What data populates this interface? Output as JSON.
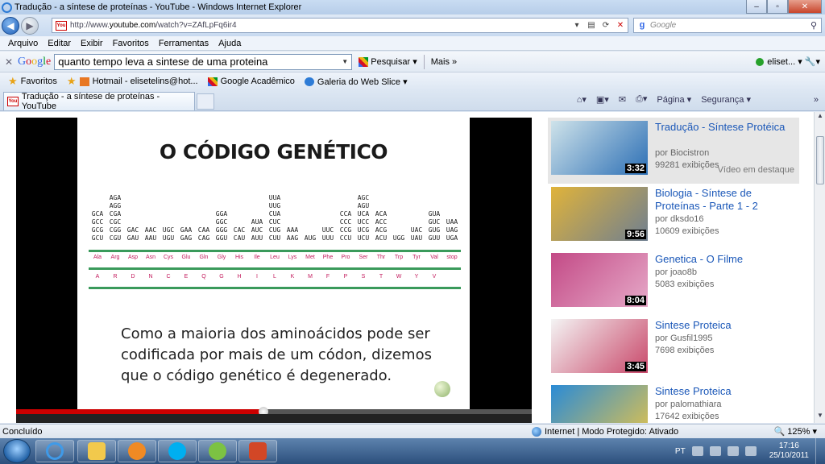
{
  "window": {
    "title": "Tradução - a síntese de proteínas - YouTube - Windows Internet Explorer",
    "buttons": [
      "–",
      "▫",
      "✕"
    ]
  },
  "address_bar": {
    "url_prefix": "http://www.",
    "url_domain": "youtube.com",
    "url_path": "/watch?v=ZAfLpFq6ir4",
    "search_placeholder": "Google"
  },
  "menu": [
    "Arquivo",
    "Editar",
    "Exibir",
    "Favoritos",
    "Ferramentas",
    "Ajuda"
  ],
  "google_toolbar": {
    "logo": "Google",
    "query": "quanto tempo leva a sintese de uma proteina",
    "search_label": "Pesquisar ▾",
    "more_label": "Mais »",
    "user_label": "eliset..."
  },
  "favorites_bar": {
    "label": "Favoritos",
    "items": [
      "Hotmail - elisetelins@hot...",
      "Google Acadêmico",
      "Galeria do Web Slice ▾"
    ]
  },
  "tabs": [
    {
      "label": "Tradução - a síntese de proteínas - YouTube"
    }
  ],
  "command_bar": {
    "page_label": "Página ▾",
    "security_label": "Segurança ▾"
  },
  "slide": {
    "title": "O CÓDIGO GENÉTICO",
    "codon_columns": [
      [
        "GCA",
        "GCC",
        "GCG",
        "GCU"
      ],
      [
        "AGA",
        "AGG",
        "CGA",
        "CGC",
        "CGG",
        "CGU"
      ],
      [
        "GAC",
        "GAU"
      ],
      [
        "AAC",
        "AAU"
      ],
      [
        "UGC",
        "UGU"
      ],
      [
        "GAA",
        "GAG"
      ],
      [
        "CAA",
        "CAG"
      ],
      [
        "GGA",
        "GGC",
        "GGG",
        "GGU"
      ],
      [
        "CAC",
        "CAU"
      ],
      [
        "AUA",
        "AUC",
        "AUU"
      ],
      [
        "UUA",
        "UUG",
        "CUA",
        "CUC",
        "CUG",
        "CUU"
      ],
      [
        "AAA",
        "AAG"
      ],
      [
        "AUG"
      ],
      [
        "UUC",
        "UUU"
      ],
      [
        "CCA",
        "CCC",
        "CCG",
        "CCU"
      ],
      [
        "AGC",
        "AGU",
        "UCA",
        "UCC",
        "UCG",
        "UCU"
      ],
      [
        "ACA",
        "ACC",
        "ACG",
        "ACU"
      ],
      [
        "UGG"
      ],
      [
        "UAC",
        "UAU"
      ],
      [
        "GUA",
        "GUC",
        "GUG",
        "GUU"
      ],
      [
        "UAA",
        "UAG",
        "UGA"
      ]
    ],
    "amino_acids": [
      "Ala",
      "Arg",
      "Asp",
      "Asn",
      "Cys",
      "Glu",
      "Gln",
      "Gly",
      "His",
      "Ile",
      "Leu",
      "Lys",
      "Met",
      "Phe",
      "Pro",
      "Ser",
      "Thr",
      "Trp",
      "Tyr",
      "Val",
      "stop"
    ],
    "letters": [
      "A",
      "R",
      "D",
      "N",
      "C",
      "E",
      "Q",
      "G",
      "H",
      "I",
      "L",
      "K",
      "M",
      "F",
      "P",
      "S",
      "T",
      "W",
      "Y",
      "V",
      ""
    ],
    "note": "Como a maioria dos aminoácidos pode ser codificada por mais de um códon, dizemos que o código genético é degenerado."
  },
  "player": {
    "progress": 0.48
  },
  "related": [
    {
      "title": "Tradução - Síntese Protéica",
      "by": "por Biocistron",
      "views": "99281 exibições",
      "duration": "3:32",
      "featured": "Vídeo em destaque",
      "thumb_colors": [
        "#cfe3ea",
        "#2c6fb5"
      ]
    },
    {
      "title": "Biologia - Síntese de Proteínas - Parte 1 - 2",
      "by": "por dksdo16",
      "views": "10609 exibições",
      "duration": "9:56",
      "featured": "",
      "thumb_colors": [
        "#e0b33a",
        "#6f7f91"
      ]
    },
    {
      "title": "Genetica - O Filme",
      "by": "por joao8b",
      "views": "5083 exibições",
      "duration": "8:04",
      "featured": "",
      "thumb_colors": [
        "#c34a86",
        "#e6a9c8"
      ]
    },
    {
      "title": "Sintese Proteica",
      "by": "por Gusfil1995",
      "views": "7698 exibições",
      "duration": "3:45",
      "featured": "",
      "thumb_colors": [
        "#f4f4f4",
        "#c9486a"
      ]
    },
    {
      "title": "Sintese Proteica",
      "by": "por palomathiara",
      "views": "17642 exibições",
      "duration": "",
      "featured": "",
      "thumb_colors": [
        "#2a8bd6",
        "#e0c24e"
      ]
    }
  ],
  "status_bar": {
    "status": "Concluído",
    "zone": "Internet | Modo Protegido: Ativado",
    "zoom": "125% ▾"
  },
  "taskbar": {
    "lang": "PT",
    "time": "17:16",
    "date": "25/10/2011"
  }
}
